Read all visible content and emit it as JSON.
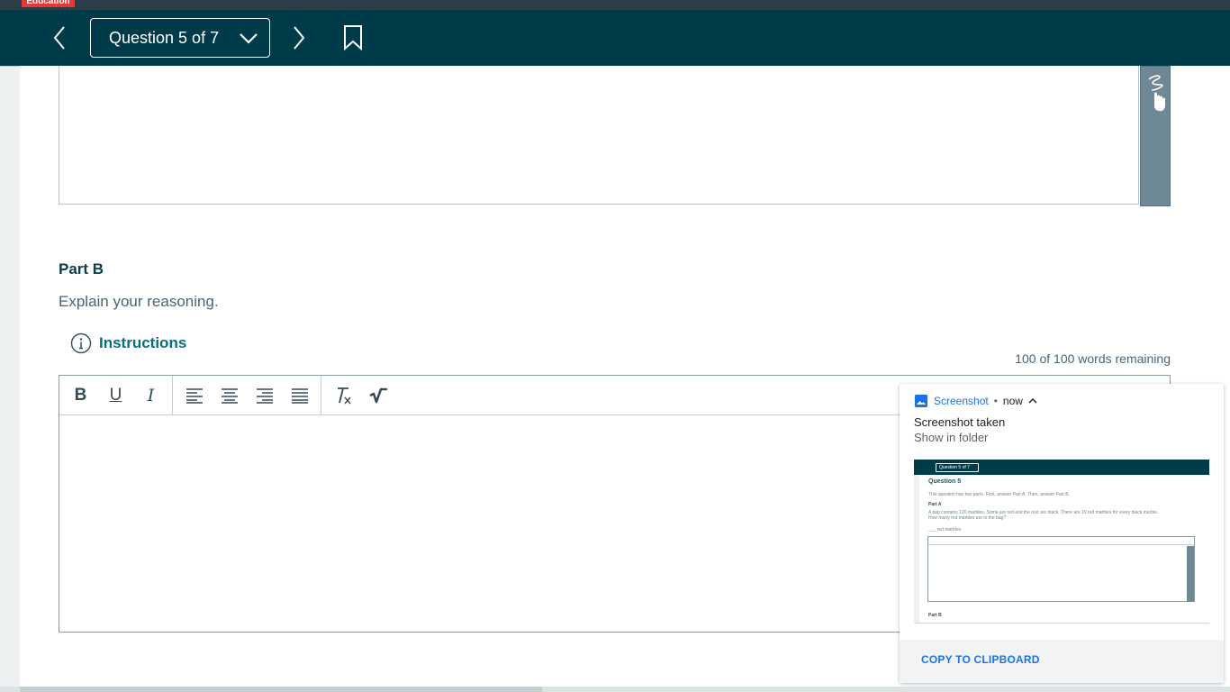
{
  "brand": {
    "badge": "Education"
  },
  "nav": {
    "question_label": "Question 5 of 7"
  },
  "part_b": {
    "title": "Part B",
    "prompt": "Explain your reasoning.",
    "instructions_label": "Instructions",
    "word_count": "100 of 100 words remaining"
  },
  "toolbar": {
    "bold": "B",
    "underline": "U",
    "italic": "I"
  },
  "notification": {
    "app": "Screenshot",
    "separator": "•",
    "time": "now",
    "title": "Screenshot taken",
    "subtitle": "Show in folder",
    "action": "COPY TO CLIPBOARD",
    "preview": {
      "nav_label": "Question 5 of 7",
      "heading": "Question 5",
      "intro": "This question has two parts. First, answer Part A. Then, answer Part B.",
      "part_a": "Part A",
      "body1": "A bag contains 120 marbles. Some are red and the rest are black. There are 19 red marbles for every black marble.",
      "body2": "How many red marbles are in the bag?",
      "answer_hint": "___ red marbles",
      "part_b": "Part B"
    }
  },
  "colors": {
    "nav_bg": "#003b4a",
    "accent_teal": "#00707f",
    "brand_red": "#e53935",
    "link_blue": "#1a73e8"
  }
}
